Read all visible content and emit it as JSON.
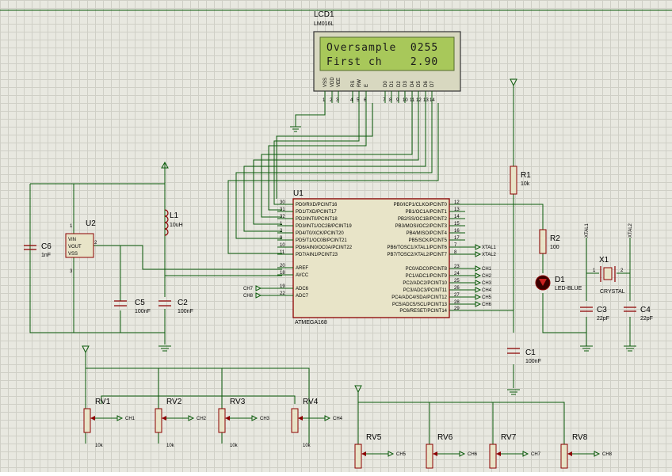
{
  "lcd": {
    "ref": "LCD1",
    "model": "LM016L",
    "line1": "Oversample  0255",
    "line2": "First ch    2.90",
    "pins": [
      "VSS",
      "VDD",
      "VEE",
      "RS",
      "RW",
      "E",
      "D0",
      "D1",
      "D2",
      "D3",
      "D4",
      "D5",
      "D6",
      "D7"
    ],
    "pin_numbers": [
      "1",
      "2",
      "3",
      "4",
      "5",
      "6",
      "7",
      "8",
      "9",
      "10",
      "11",
      "12",
      "13",
      "14"
    ]
  },
  "mcu": {
    "ref": "U1",
    "model": "ATMEGA168",
    "left_pins": [
      {
        "num": "30",
        "name": "PD0/RXD/PCINT16"
      },
      {
        "num": "31",
        "name": "PD1/TXD/PCINT17"
      },
      {
        "num": "32",
        "name": "PD2/INT0/PCINT18"
      },
      {
        "num": "1",
        "name": "PD3/INT1/OC2B/PCINT19"
      },
      {
        "num": "2",
        "name": "PD4/T0/XCK/PCINT20"
      },
      {
        "num": "9",
        "name": "PD5/T1/OC0B/PCINT21"
      },
      {
        "num": "10",
        "name": "PD6/AIN0/OC0A/PCINT22"
      },
      {
        "num": "11",
        "name": "PD7/AIN1/PCINT23"
      },
      {
        "num": "20",
        "name": "AREF"
      },
      {
        "num": "18",
        "name": "AVCC"
      },
      {
        "num": "19",
        "name": "ADC6"
      },
      {
        "num": "22",
        "name": "ADC7"
      }
    ],
    "right_pins": [
      {
        "num": "12",
        "name": "PB0/ICP1/CLKO/PCINT0"
      },
      {
        "num": "13",
        "name": "PB1/OC1A/PCINT1"
      },
      {
        "num": "14",
        "name": "PB2/SS/OC1B/PCINT2"
      },
      {
        "num": "15",
        "name": "PB3/MOSI/OC2/PCINT3"
      },
      {
        "num": "16",
        "name": "PB4/MISO/PCINT4"
      },
      {
        "num": "17",
        "name": "PB5/SCK/PCINT5"
      },
      {
        "num": "7",
        "name": "PB6/TOSC1/XTAL1/PCINT6"
      },
      {
        "num": "8",
        "name": "PB7/TOSC2/XTAL2/PCINT7"
      },
      {
        "num": "23",
        "name": "PC0/ADC0/PCINT8"
      },
      {
        "num": "24",
        "name": "PC1/ADC1/PCINT9"
      },
      {
        "num": "25",
        "name": "PC2/ADC2/PCINT10"
      },
      {
        "num": "26",
        "name": "PC3/ADC3/PCINT11"
      },
      {
        "num": "27",
        "name": "PC4/ADC4/SDA/PCINT12"
      },
      {
        "num": "28",
        "name": "PC5/ADC5/SCL/PCINT13"
      },
      {
        "num": "29",
        "name": "PC6/RESET/PCINT14"
      }
    ],
    "right_terminals": [
      "",
      "",
      "",
      "",
      "",
      "",
      "XTAL1",
      "XTAL2",
      "CH1",
      "CH2",
      "CH3",
      "CH4",
      "CH5",
      "CH6",
      ""
    ],
    "left_terminals": [
      "CH7",
      "CH8"
    ]
  },
  "u2": {
    "ref": "U2",
    "pins": [
      "VIN",
      "VOUT",
      "VSS"
    ],
    "pin_numbers": [
      "1",
      "2",
      "3"
    ]
  },
  "l1": {
    "ref": "L1",
    "value": "10uH"
  },
  "c6": {
    "ref": "C6",
    "value": "1nF"
  },
  "c5": {
    "ref": "C5",
    "value": "100nF"
  },
  "c2": {
    "ref": "C2",
    "value": "100nF"
  },
  "c1": {
    "ref": "C1",
    "value": "100nF"
  },
  "c3": {
    "ref": "C3",
    "value": "22pF"
  },
  "c4": {
    "ref": "C4",
    "value": "22pF"
  },
  "r1": {
    "ref": "R1",
    "value": "10k"
  },
  "r2": {
    "ref": "R2",
    "value": "100"
  },
  "d1": {
    "ref": "D1",
    "value": "LED-BLUE"
  },
  "x1": {
    "ref": "X1",
    "value": "CRYSTAL",
    "pin_left": "1",
    "pin_right": "2"
  },
  "xtal_labels": [
    "XTAL1",
    "XTAL2"
  ],
  "pots_top": [
    {
      "ref": "RV1",
      "value": "10k",
      "net": "CH1"
    },
    {
      "ref": "RV2",
      "value": "10k",
      "net": "CH2"
    },
    {
      "ref": "RV3",
      "value": "10k",
      "net": "CH3"
    },
    {
      "ref": "RV4",
      "value": "10k",
      "net": "CH4"
    }
  ],
  "pots_bottom": [
    {
      "ref": "RV5",
      "net": "CH5"
    },
    {
      "ref": "RV6",
      "net": "CH6"
    },
    {
      "ref": "RV7",
      "net": "CH7"
    },
    {
      "ref": "RV8",
      "net": "CH8"
    }
  ]
}
